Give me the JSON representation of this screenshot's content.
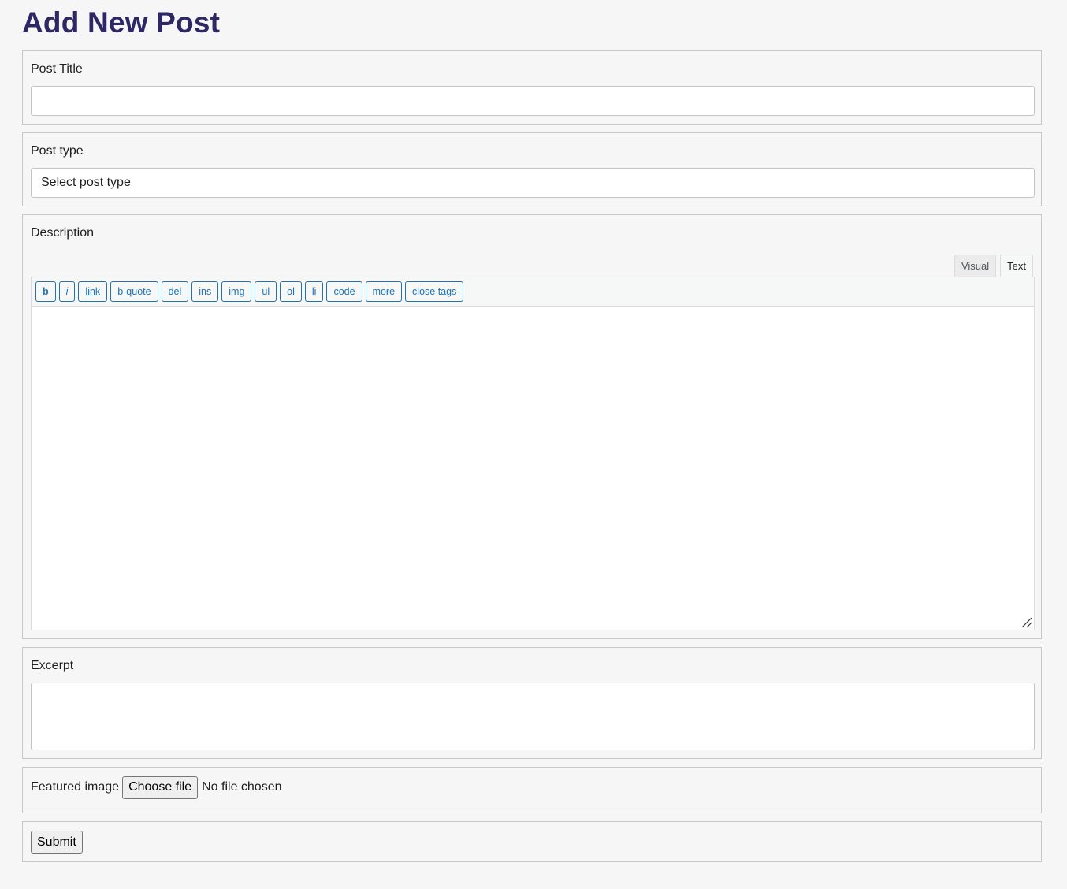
{
  "page": {
    "title": "Add New Post",
    "title_color": "#2e2766"
  },
  "post_title": {
    "label": "Post Title",
    "value": "",
    "placeholder": ""
  },
  "post_type": {
    "label": "Post type",
    "selected": "Select post type"
  },
  "description": {
    "label": "Description",
    "tabs": [
      "Visual",
      "Text"
    ],
    "active_tab": "Text",
    "quicktags": [
      "b",
      "i",
      "link",
      "b-quote",
      "del",
      "ins",
      "img",
      "ul",
      "ol",
      "li",
      "code",
      "more",
      "close tags"
    ],
    "quicktag_color": "#2271b1",
    "value": ""
  },
  "excerpt": {
    "label": "Excerpt",
    "value": ""
  },
  "featured_image": {
    "label": "Featured image",
    "button_label": "Choose file",
    "status": "No file chosen"
  },
  "submit": {
    "label": "Submit"
  }
}
